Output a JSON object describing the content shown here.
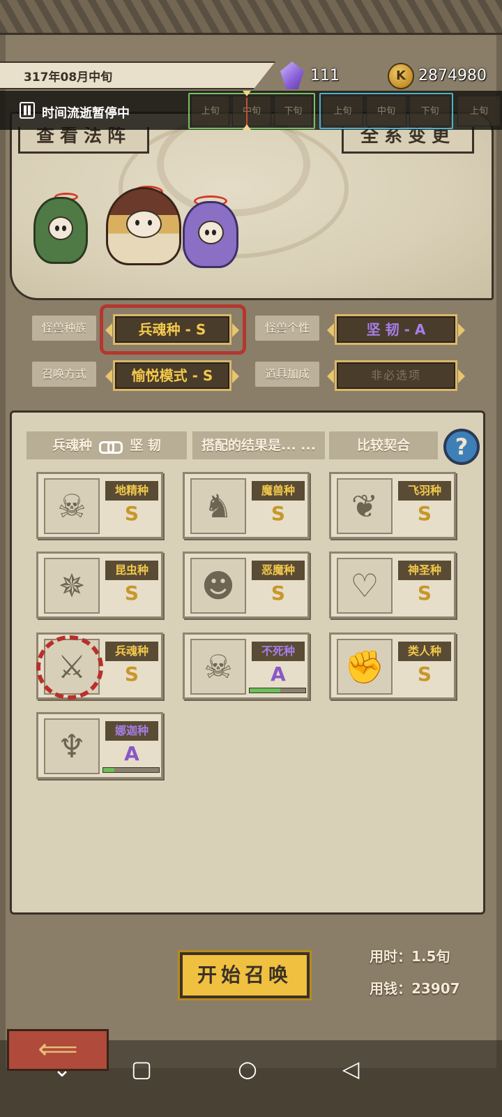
{
  "header": {
    "date": "317年08月中旬",
    "crystal_count": "111",
    "coin_symbol": "K",
    "coin_count": "2874980"
  },
  "pause_bar": {
    "text": "时间流逝暂停中",
    "timeline_current": [
      "上旬",
      "中旬",
      "下旬"
    ],
    "timeline_next": [
      "上旬",
      "中旬",
      "下旬"
    ],
    "timeline_partial": "上旬"
  },
  "top_buttons": {
    "left": "查看法阵",
    "right": "全系变更"
  },
  "selectors": {
    "race_label": "怪兽种族",
    "race_value": "兵魂种 - S",
    "personality_label": "怪兽个性",
    "personality_value": "坚  韧 - A",
    "summon_label": "召唤方式",
    "summon_value": "愉悦模式 - S",
    "item_label": "道具加成",
    "item_value": "非必选项"
  },
  "tabs": {
    "combo_left": "兵魂种",
    "combo_right": "坚  韧",
    "result": "搭配的结果是... ...",
    "compare": "比较契合",
    "help": "?"
  },
  "races": [
    {
      "name": "地精种",
      "grade": "S",
      "icon": "skull-bird-icon",
      "glyph": "☠"
    },
    {
      "name": "魔兽种",
      "grade": "S",
      "icon": "beast-icon",
      "glyph": "♞"
    },
    {
      "name": "飞羽种",
      "grade": "S",
      "icon": "wings-icon",
      "glyph": "❦"
    },
    {
      "name": "昆虫种",
      "grade": "S",
      "icon": "spider-icon",
      "glyph": "✵"
    },
    {
      "name": "恶魔种",
      "grade": "S",
      "icon": "demon-icon",
      "glyph": "☻"
    },
    {
      "name": "神圣种",
      "grade": "S",
      "icon": "angel-icon",
      "glyph": "♡"
    },
    {
      "name": "兵魂种",
      "grade": "S",
      "icon": "sword-ghost-icon",
      "glyph": "⚔"
    },
    {
      "name": "不死种",
      "grade": "A",
      "icon": "undead-skull-icon",
      "glyph": "☠",
      "progress": 0.55
    },
    {
      "name": "类人种",
      "grade": "S",
      "icon": "fist-icon",
      "glyph": "✊"
    },
    {
      "name": "娜迦种",
      "grade": "A",
      "icon": "trident-icon",
      "glyph": "♆",
      "progress": 0.2
    }
  ],
  "colors": {
    "grade_s": "#c8962a",
    "grade_a": "#8a57c8",
    "name_gold": "#f2c94c",
    "name_purple": "#a77ee8",
    "progress": "#6cbf5a"
  },
  "bottom": {
    "start_button": "开始召唤",
    "time_used": "用时：1.5旬",
    "money_used": "用钱：23907"
  },
  "navbar": {
    "back_icon": "chevron-down-icon",
    "home_icon": "square-icon",
    "circle_icon": "circle-icon",
    "triangle_icon": "triangle-back-icon"
  }
}
